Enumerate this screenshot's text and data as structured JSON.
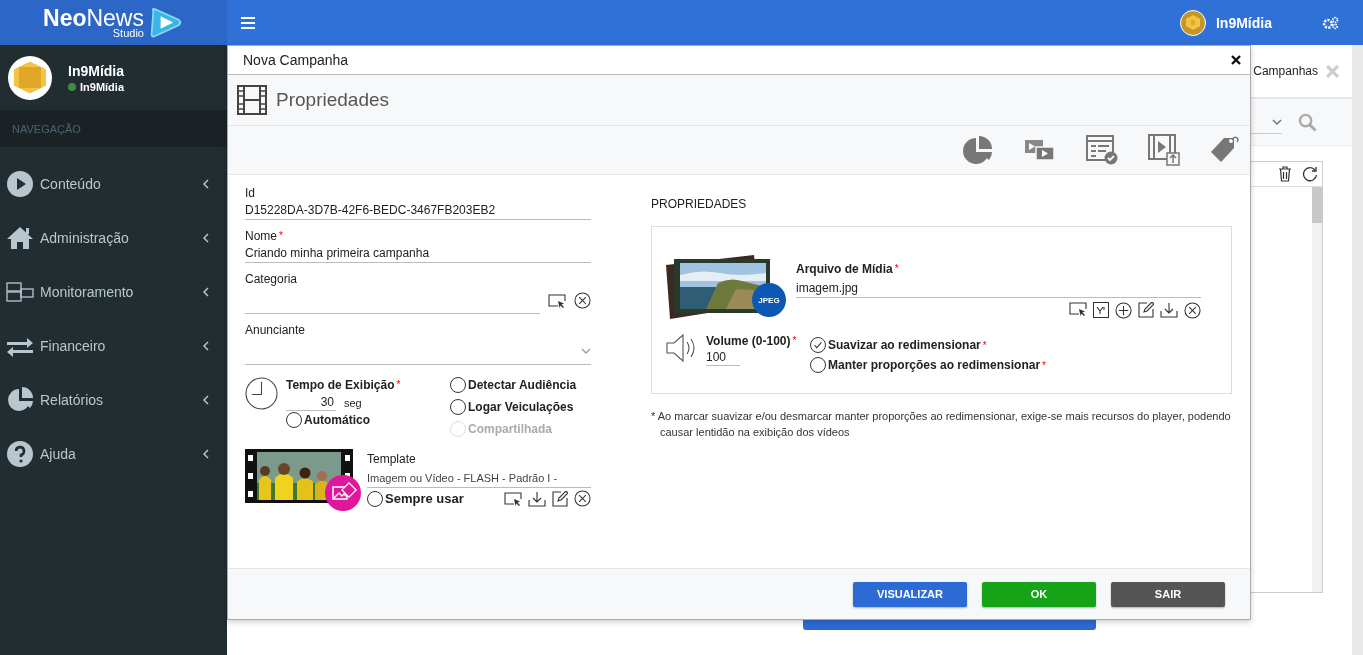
{
  "app": {
    "logo": "**Neo**News",
    "logo_sub": "Studio",
    "user_name": "In9Mídia"
  },
  "sidebar": {
    "user": {
      "name": "In9Mídia",
      "status": "In9Mídia",
      "online": true
    },
    "section": "NAVEGAÇÃO",
    "items": [
      {
        "label": "Conteúdo",
        "kind": "play"
      },
      {
        "label": "Administração",
        "kind": "home"
      },
      {
        "label": "Monitoramento",
        "kind": "monitor"
      },
      {
        "label": "Financeiro",
        "kind": "transfer"
      },
      {
        "label": "Relatórios",
        "kind": "pie"
      },
      {
        "label": "Ajuda",
        "kind": "help"
      }
    ]
  },
  "background": {
    "tab_label": "Campanhas"
  },
  "modal": {
    "title": "Nova Campanha",
    "section_title": "Propriedades",
    "fields": [
      {
        "label": "Id",
        "value": "D15228DA-3D7B-42F6-BEDC-3467FB203EB2",
        "kind": "text"
      },
      {
        "label": "Nome",
        "mark": "*",
        "value": "Criando minha primeira campanha",
        "kind": "text"
      },
      {
        "label": "Categoria",
        "kind": "picker"
      },
      {
        "label": "Anunciante",
        "kind": "select"
      }
    ],
    "display_time": {
      "label": "Tempo de Exibição",
      "mark": "*",
      "value": "30",
      "unit": "seg",
      "automatic": {
        "label": "Automático",
        "checked": false
      }
    },
    "options": [
      {
        "label": "Detectar Audiência",
        "checked": false,
        "disabled": false
      },
      {
        "label": "Logar Veiculações",
        "checked": false,
        "disabled": false
      },
      {
        "label": "Compartilhada",
        "checked": false,
        "disabled": true
      }
    ],
    "template": {
      "label": "Template",
      "value": "Imagem ou Vídeo - FLASH - Padrão I -",
      "always_use": {
        "label": "Sempre usar",
        "checked": false
      }
    },
    "properties": {
      "heading": "PROPRIEDADES",
      "media": {
        "label": "Arquivo de Mídia",
        "mark": "*",
        "value": "imagem.jpg",
        "badge": "JPEG"
      },
      "volume": {
        "label": "Volume (0-100)",
        "mark": "*",
        "value": "100"
      },
      "options": [
        {
          "label": "Suavizar ao redimensionar",
          "mark": "*",
          "checked": true
        },
        {
          "label": "Manter proporções ao redimensionar",
          "mark": "*",
          "checked": false
        }
      ],
      "note": "* Ao marcar suavizar e/ou desmarcar manter proporções ao redimensionar, exige-se mais recursos do player, podendo causar lentidão na exibição dos vídeos"
    },
    "buttons": [
      {
        "label": "VISUALIZAR",
        "kind": "primary"
      },
      {
        "label": "OK",
        "kind": "success"
      },
      {
        "label": "SAIR",
        "kind": "dark"
      }
    ]
  }
}
